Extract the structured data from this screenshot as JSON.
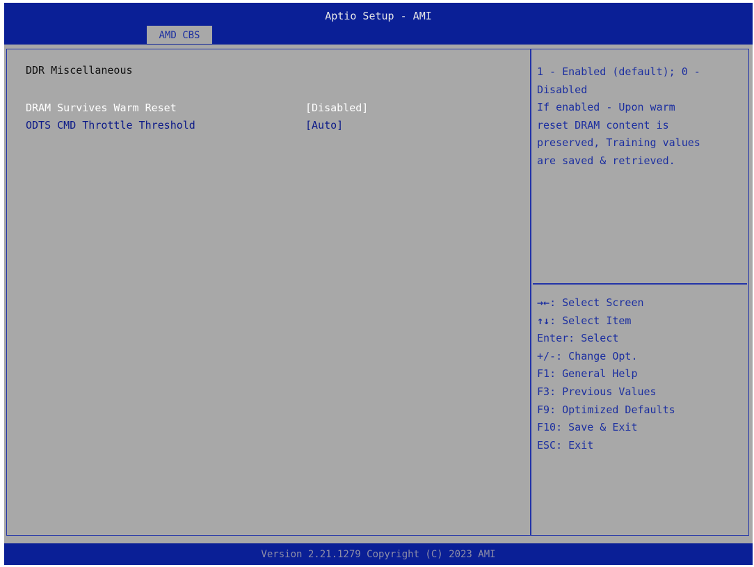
{
  "header": {
    "title": "Aptio Setup - AMI",
    "tab": "AMD CBS"
  },
  "main": {
    "section_title": "DDR Miscellaneous",
    "items": [
      {
        "label": "DRAM Survives Warm Reset",
        "value": "[Disabled]"
      },
      {
        "label": "ODTS CMD Throttle Threshold",
        "value": "[Auto]"
      }
    ]
  },
  "help": {
    "lines": [
      "1 - Enabled (default); 0 -",
      "Disabled",
      "If enabled - Upon warm",
      "reset DRAM content is",
      "preserved, Training values",
      "are saved & retrieved."
    ]
  },
  "keys": [
    {
      "key": "→←",
      "desc": ": Select Screen"
    },
    {
      "key": "↑↓",
      "desc": ": Select Item"
    },
    {
      "key": "Enter",
      "desc": ": Select"
    },
    {
      "key": "+/-",
      "desc": ": Change Opt."
    },
    {
      "key": "F1",
      "desc": ": General Help"
    },
    {
      "key": "F3",
      "desc": ": Previous Values"
    },
    {
      "key": "F9",
      "desc": ": Optimized Defaults"
    },
    {
      "key": "F10",
      "desc": ": Save & Exit"
    },
    {
      "key": "ESC",
      "desc": ": Exit"
    }
  ],
  "footer": {
    "text": "Version 2.21.1279 Copyright (C) 2023 AMI"
  },
  "colors": {
    "header_blue": "#0a1f96",
    "background_gray": "#a8a8a8",
    "selected_text": "#ffffff",
    "option_text": "#0c1a88",
    "help_text": "#1c2fa0"
  }
}
